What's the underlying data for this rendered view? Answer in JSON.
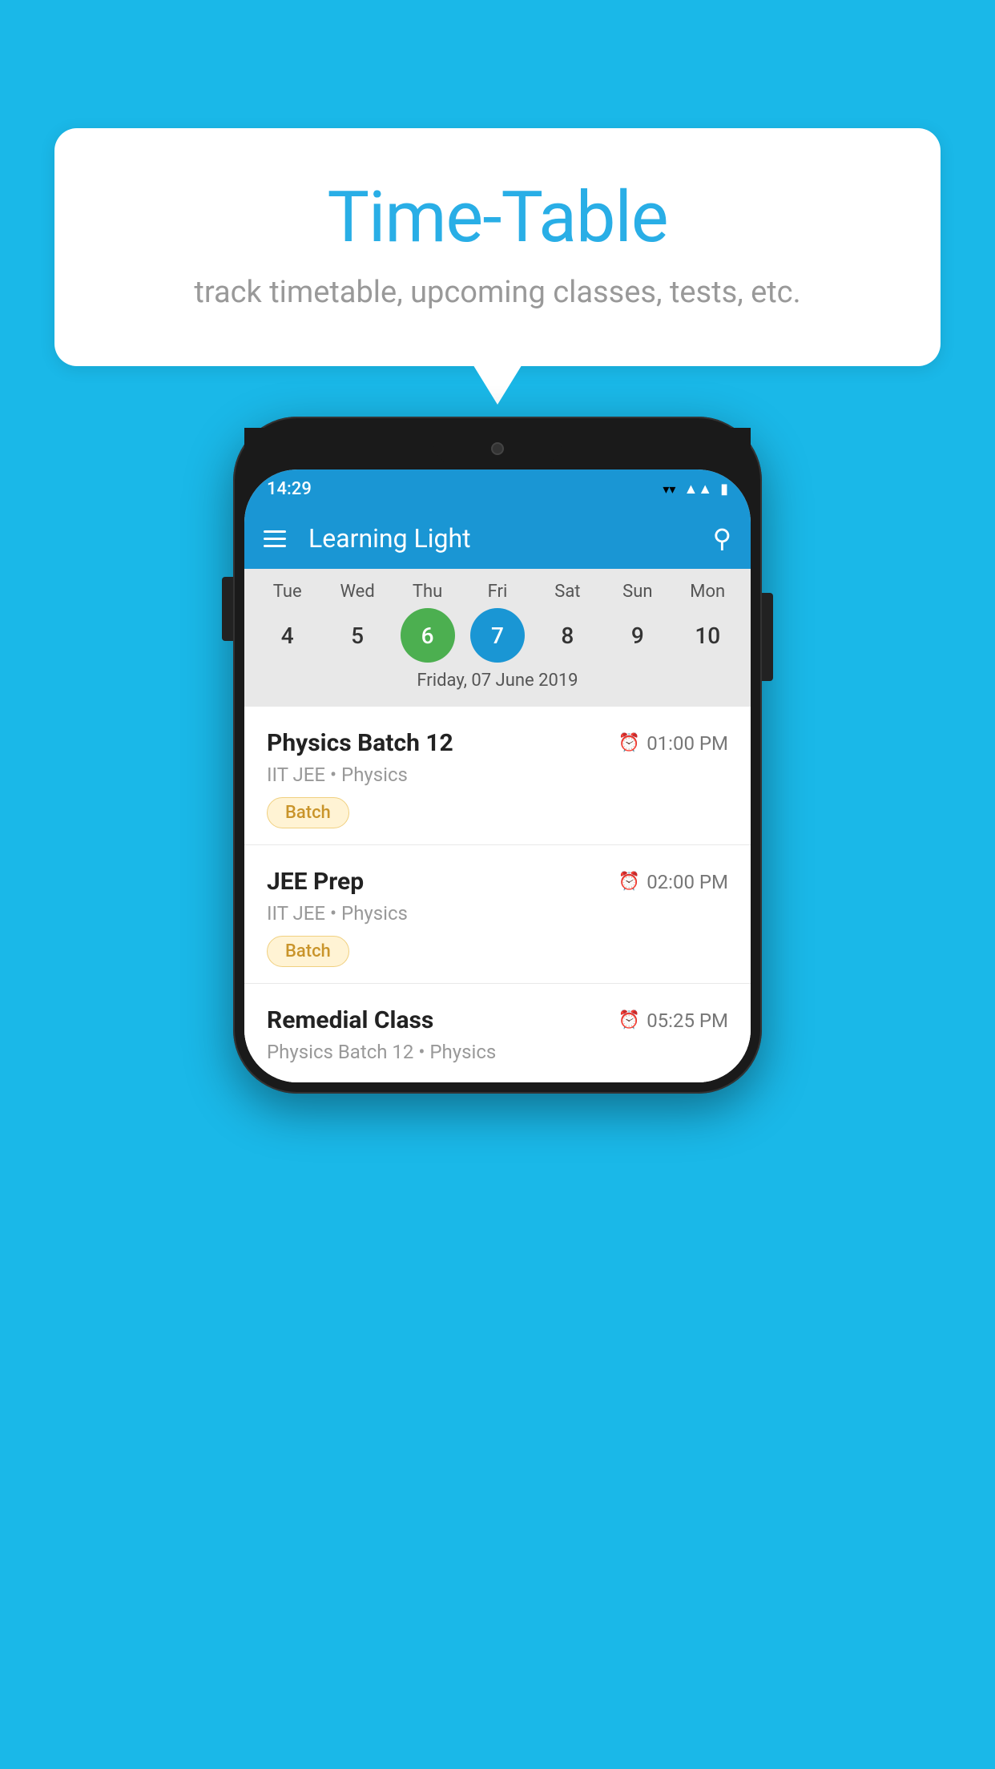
{
  "background_color": "#1ab8e8",
  "speech_bubble": {
    "title": "Time-Table",
    "subtitle": "track timetable, upcoming classes, tests, etc."
  },
  "status_bar": {
    "time": "14:29",
    "wifi": "▲",
    "signal": "▲",
    "battery": "▮"
  },
  "app_bar": {
    "title": "Learning Light"
  },
  "calendar": {
    "days": [
      "Tue",
      "Wed",
      "Thu",
      "Fri",
      "Sat",
      "Sun",
      "Mon"
    ],
    "dates": [
      4,
      5,
      6,
      7,
      8,
      9,
      10
    ],
    "today_index": 2,
    "selected_index": 3,
    "selected_label": "Friday, 07 June 2019"
  },
  "schedule_items": [
    {
      "title": "Physics Batch 12",
      "time": "01:00 PM",
      "subtitle": "IIT JEE • Physics",
      "badge": "Batch"
    },
    {
      "title": "JEE Prep",
      "time": "02:00 PM",
      "subtitle": "IIT JEE • Physics",
      "badge": "Batch"
    },
    {
      "title": "Remedial Class",
      "time": "05:25 PM",
      "subtitle": "Physics Batch 12 • Physics",
      "badge": null
    }
  ]
}
